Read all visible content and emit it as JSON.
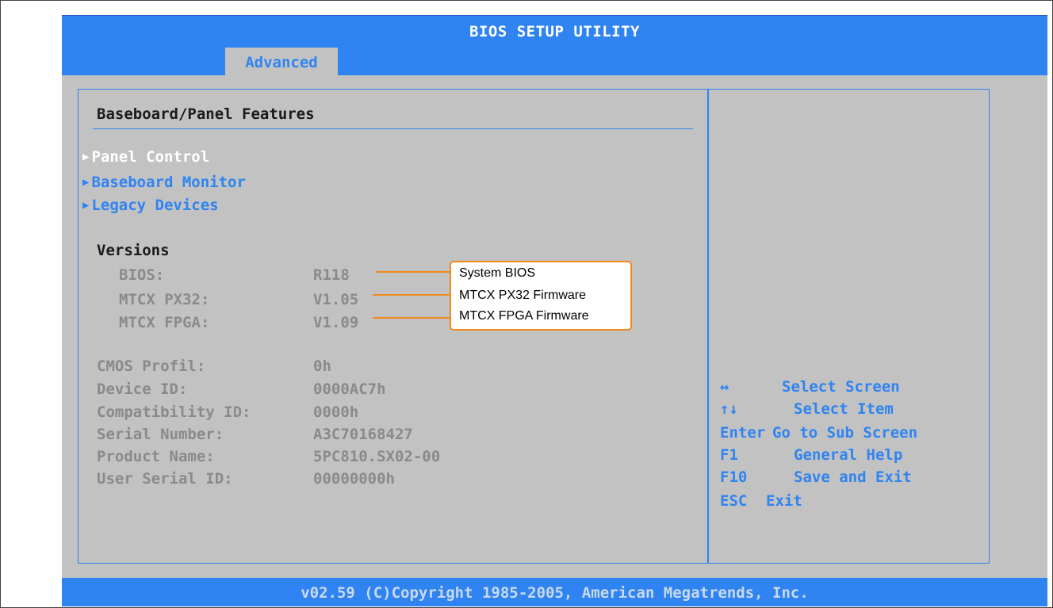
{
  "header": {
    "title": "BIOS SETUP UTILITY"
  },
  "tabs": {
    "active_label": "Advanced"
  },
  "main": {
    "section_title": "Baseboard/Panel Features",
    "menu_items": [
      {
        "label": "Panel Control",
        "selected": true
      },
      {
        "label": "Baseboard Monitor",
        "selected": false
      },
      {
        "label": "Legacy Devices",
        "selected": false
      }
    ],
    "versions_heading": "Versions",
    "versions": [
      {
        "label": "BIOS:",
        "value": "R118",
        "annotation": "System BIOS"
      },
      {
        "label": "MTCX PX32:",
        "value": "V1.05",
        "annotation": "MTCX PX32 Firmware"
      },
      {
        "label": "MTCX FPGA:",
        "value": "V1.09",
        "annotation": "MTCX FPGA Firmware"
      }
    ],
    "info": [
      {
        "label": "CMOS Profil:",
        "value": "0h"
      },
      {
        "label": "Device ID:",
        "value": "0000AC7h"
      },
      {
        "label": "Compatibility ID:",
        "value": "0000h"
      },
      {
        "label": "Serial Number:",
        "value": "A3C70168427"
      },
      {
        "label": "Product Name:",
        "value": "5PC810.SX02-00"
      },
      {
        "label": "User Serial ID:",
        "value": "00000000h"
      }
    ]
  },
  "help": [
    {
      "key": "↔",
      "desc": "Select Screen"
    },
    {
      "key": "↑↓",
      "desc": "Select Item"
    },
    {
      "key": "Enter",
      "desc": "Go to Sub Screen"
    },
    {
      "key": "F1",
      "desc": "General Help"
    },
    {
      "key": "F10",
      "desc": "Save and Exit"
    },
    {
      "key": "ESC",
      "desc": "Exit"
    }
  ],
  "footer": {
    "copyright": "v02.59 (C)Copyright 1985-2005, American Megatrends, Inc."
  },
  "colors": {
    "accent": "#2f84f1",
    "panel_bg": "#c2c2c2",
    "callout": "#f08a1a",
    "selected_text": "#ffffff",
    "disabled_text": "#8a8a8a"
  }
}
